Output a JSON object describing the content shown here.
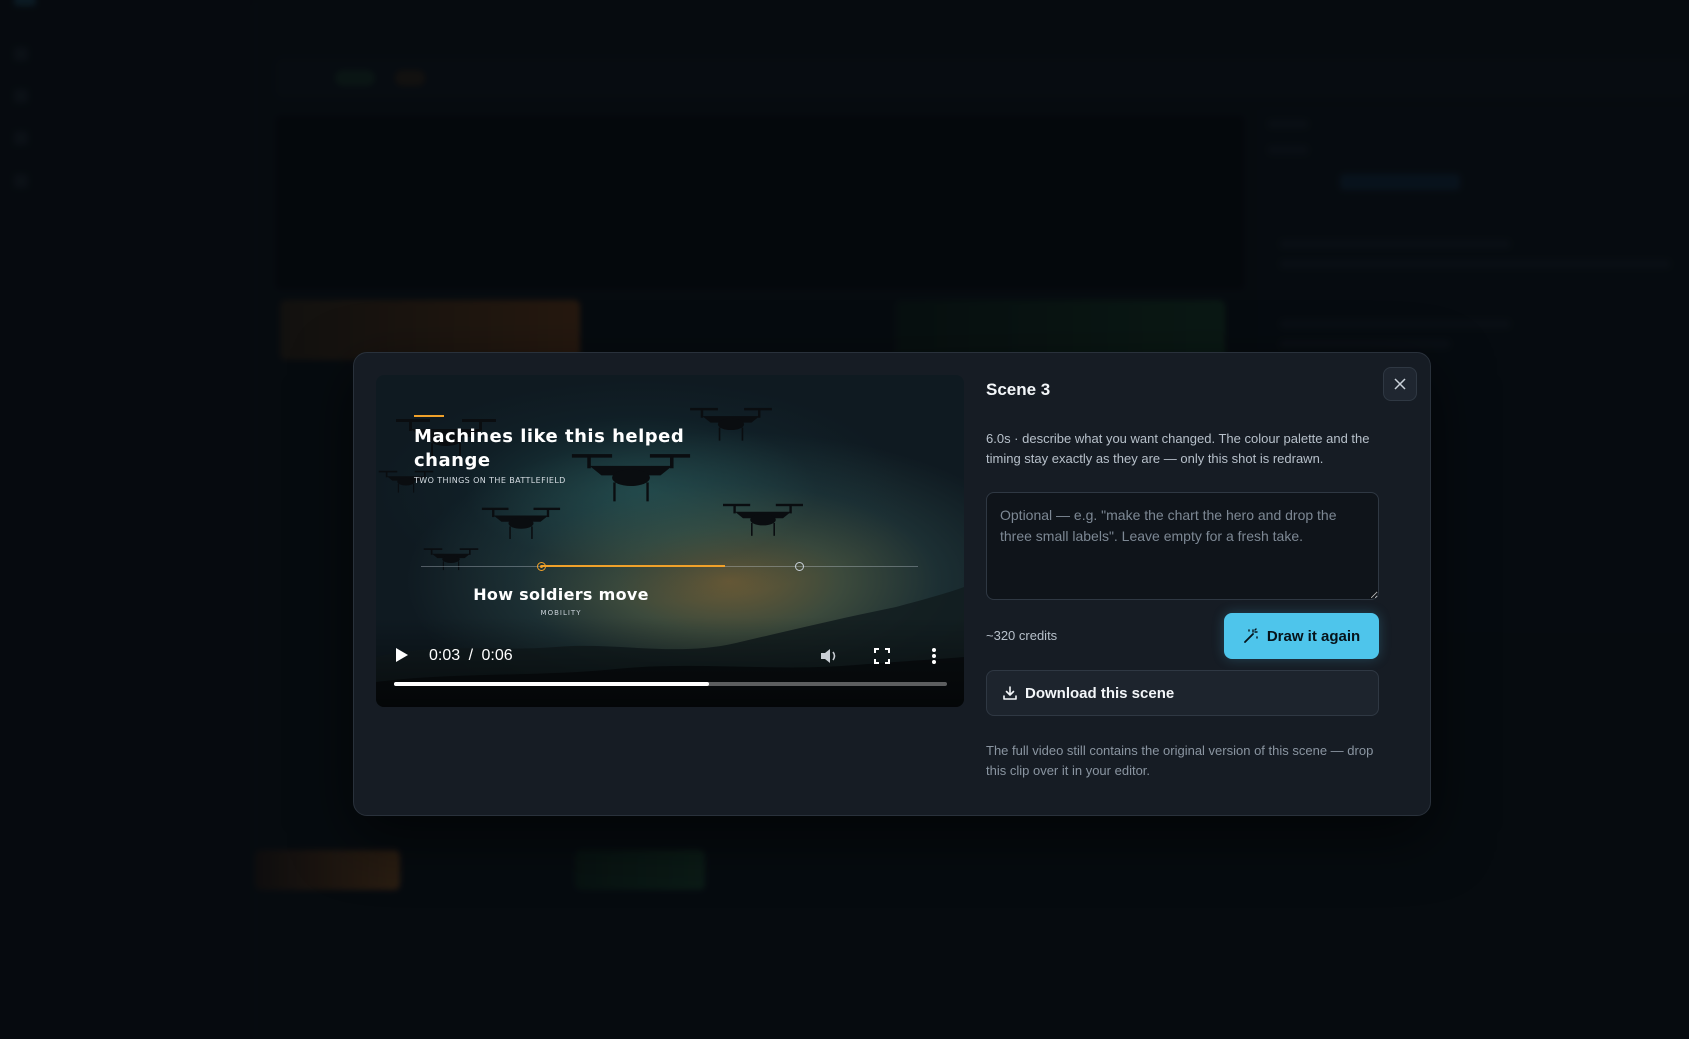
{
  "modal": {
    "title": "Scene 3",
    "description": "6.0s · describe what you want changed. The colour palette and the timing stay exactly as they are — only this shot is redrawn.",
    "prompt_value": "",
    "prompt_placeholder": "Optional — e.g. \"make the chart the hero and drop the three small labels\". Leave empty for a fresh take.",
    "credits": "~320 credits",
    "redraw_button": "Draw it again",
    "download_button": "Download this scene",
    "note": "The full video still contains the original version of this scene — drop this clip over it in your editor.",
    "close_icon": "close-icon"
  },
  "video": {
    "title": "Machines like this helped change",
    "subtitle": "TWO THINGS ON THE BATTLEFIELD",
    "caption": "How soldiers move",
    "caption_sub": "MOBILITY",
    "accent_color": "#f0a12a",
    "timeline_progress": 0.37,
    "current_time": "0:03",
    "time_separator": "/",
    "duration": "0:06",
    "playback_progress": 0.57,
    "icons": [
      "play-icon",
      "volume-icon",
      "fullscreen-icon",
      "more-options-icon"
    ]
  },
  "colors": {
    "accent": "#4ec5eb",
    "modal_bg": "#161c24",
    "page_bg": "#0a0f15"
  }
}
